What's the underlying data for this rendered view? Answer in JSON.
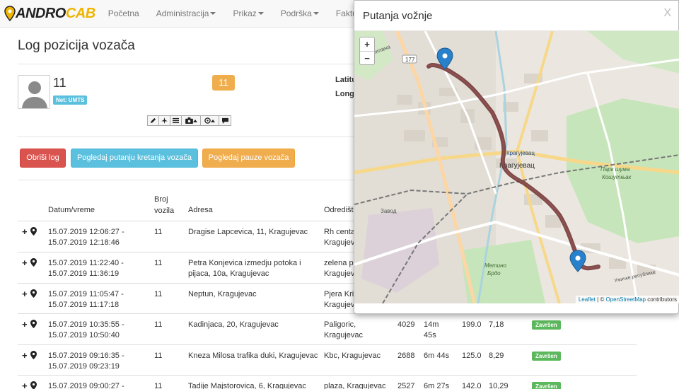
{
  "nav": {
    "brand_a": "ANDRO",
    "brand_b": "CAB",
    "items": [
      "Početna",
      "Administracija",
      "Prikaz",
      "Podrška",
      "Fakture"
    ]
  },
  "page": {
    "title": "Log pozicija vozača",
    "driver_name": "11",
    "network_badge": "Net: UMTS",
    "count_badge": "11",
    "latitude_label": "Latitu",
    "longitude_label": "Longi"
  },
  "buttons": {
    "delete_log": "Obriši log",
    "view_route": "Pogledaj putanju kretanja vozača",
    "view_pauses": "Pogledaj pauze vozača"
  },
  "table": {
    "headers": {
      "datetime": "Datum/vreme",
      "vehicle_no_1": "Broj",
      "vehicle_no_2": "vozila",
      "address": "Adresa",
      "destination": "Odredišt"
    },
    "rows": [
      {
        "dt1": "15.07.2019 12:06:27 -",
        "dt2": "15.07.2019 12:18:46",
        "vehicle": "11",
        "addr1": "Dragise Lapcevica, 11, Kragujevac",
        "addr2": "",
        "dest1": "Rh centa",
        "dest2": "Kragujev",
        "c1": "",
        "c2a": "",
        "c2b": "",
        "c3": "",
        "c4": "",
        "status": ""
      },
      {
        "dt1": "15.07.2019 11:22:40 -",
        "dt2": "15.07.2019 11:36:19",
        "vehicle": "11",
        "addr1": "Petra Konjevica izmedju potoka i",
        "addr2": "pijaca, 10a, Kragujevac",
        "dest1": "zelena p",
        "dest2": "Kragujev",
        "c1": "",
        "c2a": "",
        "c2b": "",
        "c3": "",
        "c4": "",
        "status": ""
      },
      {
        "dt1": "15.07.2019 11:05:47 -",
        "dt2": "15.07.2019 11:17:18",
        "vehicle": "11",
        "addr1": "Neptun, Kragujevac",
        "addr2": "",
        "dest1": "Pjera Kri",
        "dest2": "Kragujev",
        "c1": "",
        "c2a": "",
        "c2b": "",
        "c3": "",
        "c4": "",
        "status": ""
      },
      {
        "dt1": "15.07.2019 10:35:55 -",
        "dt2": "15.07.2019 10:50:40",
        "vehicle": "11",
        "addr1": "Kadinjaca, 20, Kragujevac",
        "addr2": "",
        "dest1": "Paligoric,",
        "dest2": "Kragujevac",
        "c1": "4029",
        "c2a": "14m",
        "c2b": "45s",
        "c3": "199.0",
        "c4": "7,18",
        "status": "Završen"
      },
      {
        "dt1": "15.07.2019 09:16:35 -",
        "dt2": "15.07.2019 09:23:19",
        "vehicle": "11",
        "addr1": "Kneza Milosa trafika duki, Kragujevac",
        "addr2": "",
        "dest1": "Kbc, Kragujevac",
        "dest2": "",
        "c1": "2688",
        "c2a": "6m 44s",
        "c2b": "",
        "c3": "125.0",
        "c4": "8,29",
        "status": "Završen"
      },
      {
        "dt1": "15.07.2019 09:00:27 -",
        "dt2": "",
        "vehicle": "11",
        "addr1": "Tadije Majstorovica, 6, Kragujevac",
        "addr2": "",
        "dest1": "plaza, Kragujevac",
        "dest2": "",
        "c1": "2527",
        "c2a": "6m 27s",
        "c2b": "",
        "c3": "142.0",
        "c4": "10,29",
        "status": "Završen"
      }
    ]
  },
  "modal": {
    "title": "Putanja vožnje",
    "close": "X",
    "zoom_in": "+",
    "zoom_out": "−",
    "attribution_leaflet": "Leaflet",
    "attribution_sep": " | © ",
    "attribution_osm": "OpenStreetMap",
    "attribution_tail": " contributors",
    "map_labels": {
      "city": "Крагујевац",
      "station": "Крагујевац",
      "park": "Парк шума",
      "park2": "Кошутњак",
      "hill": "Метино",
      "hill2": "Брдо",
      "zavod": "Завод",
      "road_177": "177",
      "street_milana": "Милана",
      "street_uzicke": "Ужичке републике"
    }
  },
  "colors": {
    "danger": "#d9534f",
    "info": "#5bc0de",
    "warning": "#f0ad4e",
    "success": "#5cb85c",
    "route": "#6b2f2f",
    "marker": "#2a81cb"
  }
}
